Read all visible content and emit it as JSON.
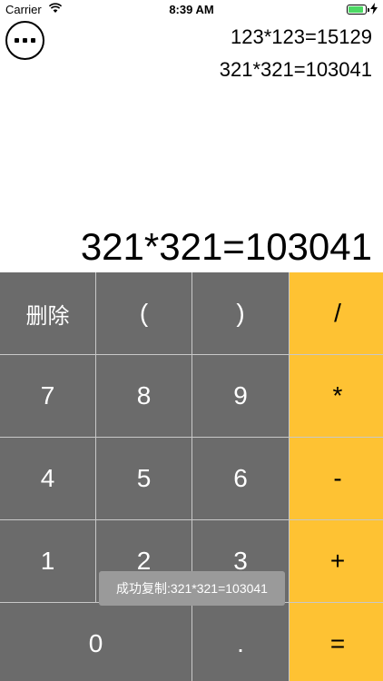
{
  "status_bar": {
    "carrier": "Carrier",
    "time": "8:39 AM",
    "battery_level": 0.9,
    "battery_color": "#4cd964"
  },
  "more_button": {
    "icon": "more-dots-icon"
  },
  "history": [
    "123*123=15129",
    "321*321=103041"
  ],
  "display": {
    "value": "321*321=103041"
  },
  "keys": [
    {
      "label": "删除",
      "name": "delete",
      "type": "func"
    },
    {
      "label": "(",
      "name": "open-paren",
      "type": "func"
    },
    {
      "label": ")",
      "name": "close-paren",
      "type": "func"
    },
    {
      "label": "/",
      "name": "divide",
      "type": "op"
    },
    {
      "label": "7",
      "name": "7",
      "type": "num"
    },
    {
      "label": "8",
      "name": "8",
      "type": "num"
    },
    {
      "label": "9",
      "name": "9",
      "type": "num"
    },
    {
      "label": "*",
      "name": "multiply",
      "type": "op"
    },
    {
      "label": "4",
      "name": "4",
      "type": "num"
    },
    {
      "label": "5",
      "name": "5",
      "type": "num"
    },
    {
      "label": "6",
      "name": "6",
      "type": "num"
    },
    {
      "label": "-",
      "name": "subtract",
      "type": "op"
    },
    {
      "label": "1",
      "name": "1",
      "type": "num"
    },
    {
      "label": "2",
      "name": "2",
      "type": "num"
    },
    {
      "label": "3",
      "name": "3",
      "type": "num"
    },
    {
      "label": "+",
      "name": "add",
      "type": "op"
    },
    {
      "label": "0",
      "name": "0",
      "type": "num",
      "wide": true
    },
    {
      "label": ".",
      "name": "decimal",
      "type": "num"
    },
    {
      "label": "=",
      "name": "equals",
      "type": "op"
    }
  ],
  "toast": {
    "text": "成功复制:321*321=103041"
  },
  "colors": {
    "key_gray": "#6b6b6b",
    "key_orange": "#fec233",
    "grid_line": "#c8c8c8",
    "toast_bg": "#9a9a9a"
  }
}
